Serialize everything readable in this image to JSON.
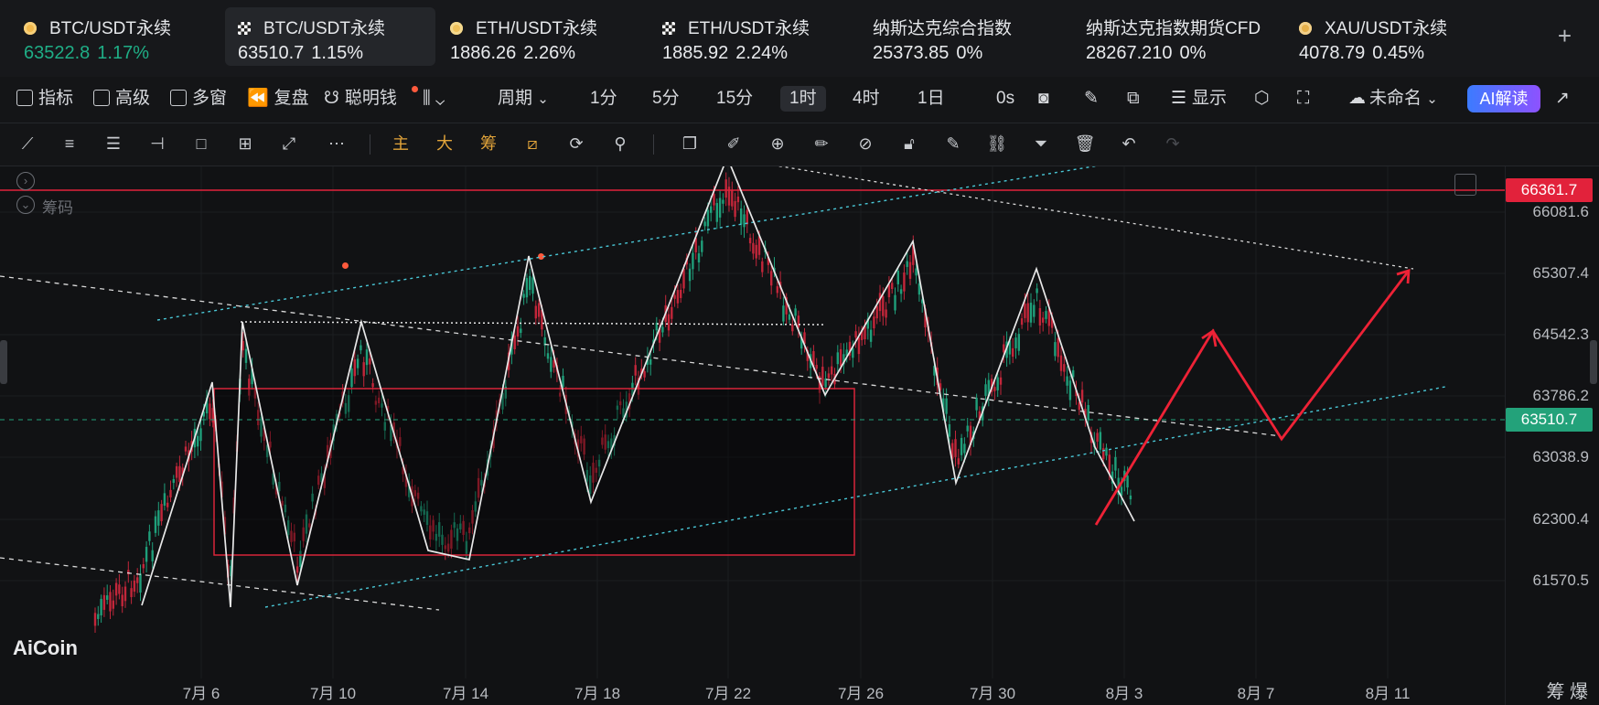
{
  "tickers": [
    {
      "name": "BTC/USDT永续",
      "price": "63522.8",
      "change": "1.17%",
      "icon": "btc-coin-icon"
    },
    {
      "name": "BTC/USDT永续",
      "price": "63510.7",
      "change": "1.15%",
      "icon": "checker-icon"
    },
    {
      "name": "ETH/USDT永续",
      "price": "1886.26",
      "change": "2.26%",
      "icon": "eth-coin-icon"
    },
    {
      "name": "ETH/USDT永续",
      "price": "1885.92",
      "change": "2.24%",
      "icon": "checker-icon"
    },
    {
      "name": "纳斯达克综合指数",
      "price": "25373.85",
      "change": "0%",
      "icon": ""
    },
    {
      "name": "纳斯达克指数期货CFD",
      "price": "28267.210",
      "change": "0%",
      "icon": ""
    },
    {
      "name": "XAU/USDT永续",
      "price": "4078.79",
      "change": "0.45%",
      "icon": "gold-coin-icon"
    }
  ],
  "plus_label": "+",
  "toolbar": {
    "indicator": "指标",
    "advanced": "高级",
    "multi_window": "多窗",
    "replay": "复盘",
    "smart_money": "聪明钱",
    "period": "周期",
    "intervals": [
      "1分",
      "5分",
      "15分",
      "1时",
      "4时",
      "1日"
    ],
    "selected_interval": "1时",
    "countdown": "0s",
    "display": "显示",
    "unnamed": "未命名",
    "ai_button": "AI解读"
  },
  "drawing_tools": {
    "main": "主",
    "big": "大",
    "chips": "筹"
  },
  "chart": {
    "chip_label": "筹码",
    "logo": "AiCoin",
    "corner_labels": "筹 爆",
    "resistance_price": "66361.7",
    "current_price": "63510.7",
    "resistance_color": "#e2223b",
    "current_color": "#23a27a",
    "y_labels": [
      "66081.6",
      "65307.4",
      "64542.3",
      "63786.2",
      "63038.9",
      "62300.4",
      "61570.5"
    ],
    "x_labels": [
      "7月 6",
      "7月 10",
      "7月 14",
      "7月 18",
      "7月 22",
      "7月 26",
      "7月 30",
      "8月 3",
      "8月 7",
      "8月 11"
    ]
  }
}
